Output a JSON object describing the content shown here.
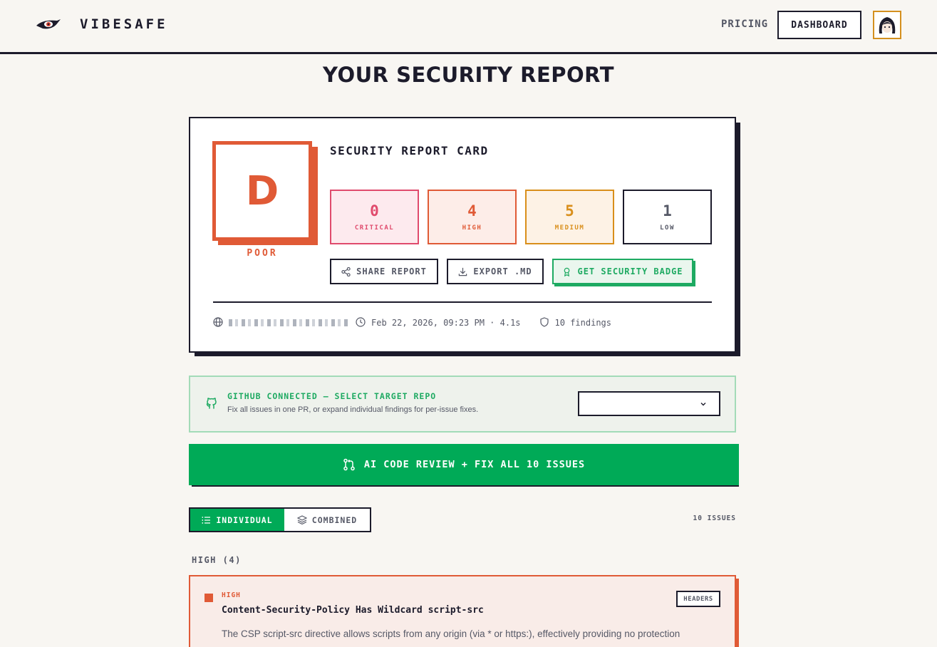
{
  "header": {
    "brand": "VIBESAFE",
    "nav_pricing": "PRICING",
    "nav_dashboard": "DASHBOARD"
  },
  "page_title": "YOUR SECURITY REPORT",
  "report_card": {
    "title": "SECURITY REPORT CARD",
    "grade": "D",
    "grade_label": "POOR",
    "severity": {
      "critical": {
        "count": "0",
        "label": "CRITICAL"
      },
      "high": {
        "count": "4",
        "label": "HIGH"
      },
      "medium": {
        "count": "5",
        "label": "MEDIUM"
      },
      "low": {
        "count": "1",
        "label": "LOW"
      }
    },
    "actions": {
      "share": "SHARE REPORT",
      "export": "EXPORT .MD",
      "badge": "GET SECURITY BADGE"
    },
    "meta": {
      "scan_info": "Feb 22, 2026, 09:23 PM · 4.1s",
      "findings": "10 findings"
    }
  },
  "github": {
    "title": "GITHUB CONNECTED — SELECT TARGET REPO",
    "subtitle": "Fix all issues in one PR, or expand individual findings for per-issue fixes."
  },
  "fix_all_button": "AI CODE REVIEW + FIX ALL 10 ISSUES",
  "view_toggle": {
    "individual": "INDIVIDUAL",
    "combined": "COMBINED"
  },
  "issues_count": "10 ISSUES",
  "groups": [
    {
      "heading": "HIGH (4)",
      "findings": [
        {
          "severity": "HIGH",
          "title": "Content-Security-Policy Has Wildcard script-src",
          "description": "The CSP script-src directive allows scripts from any origin (via * or https:), effectively providing no protection",
          "tag": "HEADERS"
        }
      ]
    }
  ],
  "colors": {
    "critical": "#e04b6d",
    "high": "#e05a36",
    "medium": "#d98f1b",
    "accent_green": "#00aa57",
    "ink": "#1c1b2b"
  }
}
